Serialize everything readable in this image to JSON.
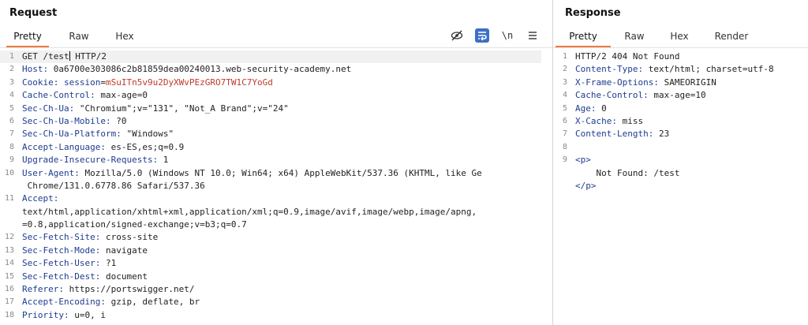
{
  "request": {
    "title": "Request",
    "tabs": [
      "Pretty",
      "Raw",
      "Hex"
    ],
    "tools": {
      "wrap_label": "\\n"
    },
    "lines": [
      {
        "n": "1",
        "text_a": "GET /test",
        "text_b": " HTTP/2"
      },
      {
        "n": "2",
        "key": "Host:",
        "val": " 0a6700e303086c2b81859dea00240013.web-security-academy.net"
      },
      {
        "n": "3",
        "key": "Cookie:",
        "ck": " session",
        "eq": "=",
        "cv": "mSuITn5v9u2DyXWvPEzGRO7TW1C7YoGd"
      },
      {
        "n": "4",
        "key": "Cache-Control:",
        "val": " max-age=0"
      },
      {
        "n": "5",
        "key": "Sec-Ch-Ua:",
        "val": " \"Chromium\";v=\"131\", \"Not_A Brand\";v=\"24\""
      },
      {
        "n": "6",
        "key": "Sec-Ch-Ua-Mobile:",
        "val": " ?0"
      },
      {
        "n": "7",
        "key": "Sec-Ch-Ua-Platform:",
        "val": " \"Windows\""
      },
      {
        "n": "8",
        "key": "Accept-Language:",
        "val": " es-ES,es;q=0.9"
      },
      {
        "n": "9",
        "key": "Upgrade-Insecure-Requests:",
        "val": " 1"
      },
      {
        "n": "10",
        "key": "User-Agent:",
        "val": " Mozilla/5.0 (Windows NT 10.0; Win64; x64) AppleWebKit/537.36 (KHTML, like Ge"
      },
      {
        "n": "",
        "val": " Chrome/131.0.6778.86 Safari/537.36"
      },
      {
        "n": "11",
        "key": "Accept:",
        "val": ""
      },
      {
        "n": "",
        "val": "text/html,application/xhtml+xml,application/xml;q=0.9,image/avif,image/webp,image/apng,"
      },
      {
        "n": "",
        "val": "=0.8,application/signed-exchange;v=b3;q=0.7"
      },
      {
        "n": "12",
        "key": "Sec-Fetch-Site:",
        "val": " cross-site"
      },
      {
        "n": "13",
        "key": "Sec-Fetch-Mode:",
        "val": " navigate"
      },
      {
        "n": "14",
        "key": "Sec-Fetch-User:",
        "val": " ?1"
      },
      {
        "n": "15",
        "key": "Sec-Fetch-Dest:",
        "val": " document"
      },
      {
        "n": "16",
        "key": "Referer:",
        "val": " https://portswigger.net/"
      },
      {
        "n": "17",
        "key": "Accept-Encoding:",
        "val": " gzip, deflate, br"
      },
      {
        "n": "18",
        "key": "Priority:",
        "val": " u=0, i"
      }
    ]
  },
  "response": {
    "title": "Response",
    "tabs": [
      "Pretty",
      "Raw",
      "Hex",
      "Render"
    ],
    "lines": [
      {
        "n": "1",
        "val": "HTTP/2 404 Not Found"
      },
      {
        "n": "2",
        "key": "Content-Type:",
        "val": " text/html; charset=utf-8"
      },
      {
        "n": "3",
        "key": "X-Frame-Options:",
        "val": " SAMEORIGIN"
      },
      {
        "n": "4",
        "key": "Cache-Control:",
        "val": " max-age=10"
      },
      {
        "n": "5",
        "key": "Age:",
        "val": " 0"
      },
      {
        "n": "6",
        "key": "X-Cache:",
        "val": " miss"
      },
      {
        "n": "7",
        "key": "Content-Length:",
        "val": " 23"
      },
      {
        "n": "8",
        "val": ""
      },
      {
        "n": "9",
        "tag": "<p>",
        "val": ""
      },
      {
        "n": "",
        "val": "    Not Found: /test"
      },
      {
        "n": "",
        "tag": "</p>",
        "val": ""
      }
    ]
  },
  "colors": {
    "accent": "#ec7a3f",
    "header_key": "#1f3b8f",
    "cookie_value": "#c0392b",
    "tool_active": "#3d6fc7"
  }
}
